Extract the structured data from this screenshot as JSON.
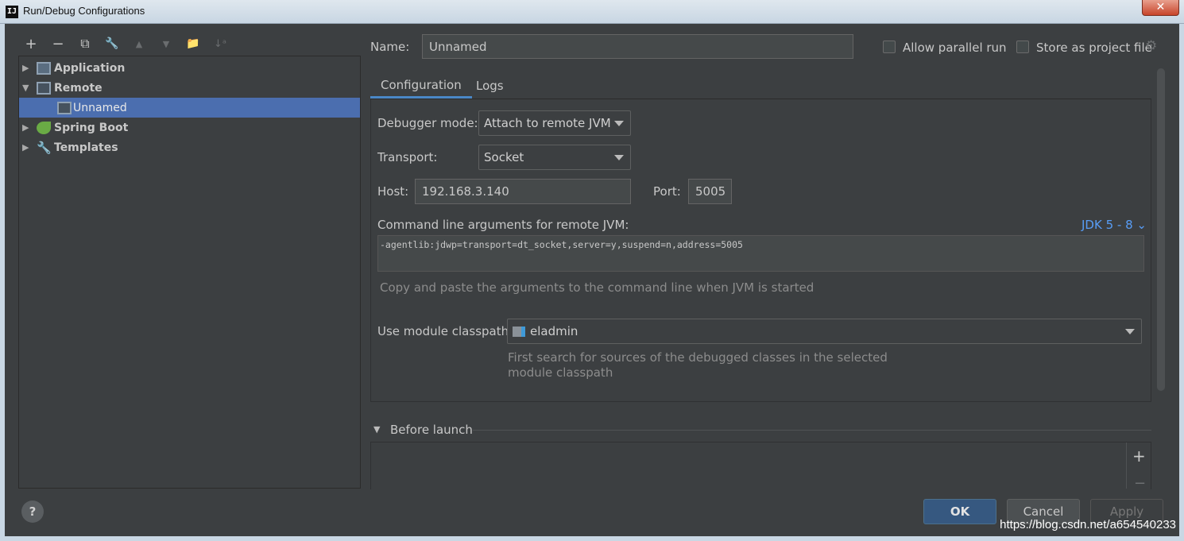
{
  "window": {
    "icon_text": "IJ",
    "title": "Run/Debug Configurations",
    "close_glyph": "✕"
  },
  "toolbar": {
    "add": "+",
    "remove": "−",
    "copy": "⧉",
    "edit_defaults": "🔧",
    "move_up": "▲",
    "move_down": "▼",
    "folder": "📁",
    "sort": "↓ᵃ"
  },
  "tree": {
    "items": [
      {
        "label": "Application",
        "arrow": "▶",
        "icon": "application-icon"
      },
      {
        "label": "Remote",
        "arrow": "▼",
        "icon": "remote-icon"
      },
      {
        "label": "Unnamed",
        "arrow": "",
        "icon": "remote-config-icon",
        "selected": true
      },
      {
        "label": "Spring Boot",
        "arrow": "▶",
        "icon": "spring-boot-icon"
      },
      {
        "label": "Templates",
        "arrow": "▶",
        "icon": "wrench-icon"
      }
    ]
  },
  "header": {
    "name_label": "Name:",
    "name_value": "Unnamed",
    "allow_parallel_label": "Allow parallel run",
    "store_project_label": "Store as project file",
    "gear": "⚙"
  },
  "tabs": [
    {
      "label": "Configuration",
      "active": true
    },
    {
      "label": "Logs",
      "active": false
    }
  ],
  "config": {
    "debugger_mode_label": "Debugger mode:",
    "debugger_mode_value": "Attach to remote JVM",
    "transport_label": "Transport:",
    "transport_value": "Socket",
    "host_label": "Host:",
    "host_value": "192.168.3.140",
    "port_label": "Port:",
    "port_value": "5005",
    "cmd_label": "Command line arguments for remote JVM:",
    "jdk_link": "JDK 5 - 8 ⌄",
    "cmd_value": "-agentlib:jdwp=transport=dt_socket,server=y,suspend=n,address=5005",
    "cmd_hint": "Copy and paste the arguments to the command line when JVM is started",
    "module_label": "Use module classpath:",
    "module_value": "eladmin",
    "module_hint_1": "First search for sources of the debugged classes in the selected",
    "module_hint_2": "module classpath"
  },
  "before_launch": {
    "label": "Before launch",
    "add": "+",
    "remove": "−"
  },
  "footer": {
    "help": "?",
    "ok": "OK",
    "cancel": "Cancel",
    "apply": "Apply"
  },
  "watermark": "https://blog.csdn.net/a654540233"
}
